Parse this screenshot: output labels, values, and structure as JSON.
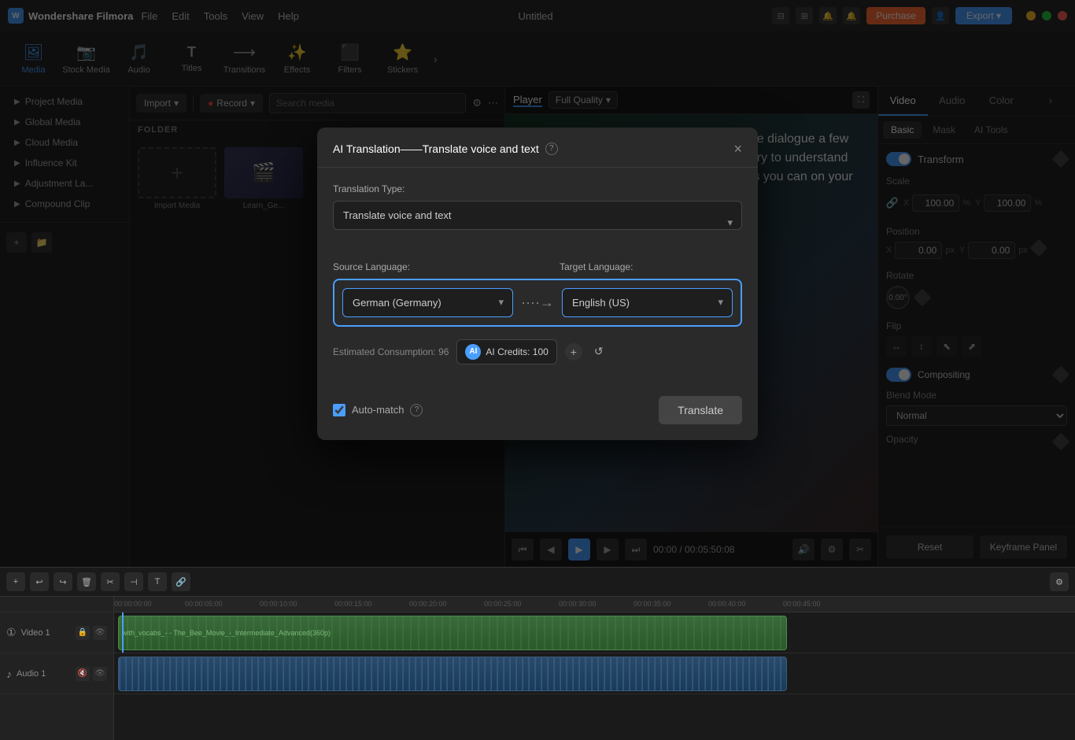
{
  "app": {
    "name": "Wondershare Filmora",
    "title": "Untitled"
  },
  "menu": {
    "items": [
      "File",
      "Edit",
      "Tools",
      "View",
      "Help"
    ]
  },
  "toolbar": {
    "items": [
      {
        "id": "media",
        "label": "Media",
        "icon": "🖼"
      },
      {
        "id": "stock",
        "label": "Stock Media",
        "icon": "📦"
      },
      {
        "id": "audio",
        "label": "Audio",
        "icon": "🎵"
      },
      {
        "id": "titles",
        "label": "Titles",
        "icon": "T"
      },
      {
        "id": "transitions",
        "label": "Transitions",
        "icon": "⟶"
      },
      {
        "id": "effects",
        "label": "Effects",
        "icon": "✨"
      },
      {
        "id": "filters",
        "label": "Filters",
        "icon": "🔲"
      },
      {
        "id": "stickers",
        "label": "Stickers",
        "icon": "⭐"
      }
    ]
  },
  "sidebar": {
    "items": [
      {
        "label": "Project Media",
        "arrow": "▶"
      },
      {
        "label": "Global Media",
        "arrow": "▶"
      },
      {
        "label": "Cloud Media",
        "arrow": "▶"
      },
      {
        "label": "Influence Kit",
        "arrow": "▶"
      },
      {
        "label": "Adjustment La...",
        "arrow": "▶"
      },
      {
        "label": "Compound Clip",
        "arrow": "▶"
      }
    ]
  },
  "media": {
    "folder_label": "FOLDER",
    "import_label": "Import",
    "record_label": "Record",
    "search_placeholder": "Search media",
    "cards": [
      {
        "label": "Import Media",
        "type": "add"
      },
      {
        "label": "Learn_Ge...",
        "type": "thumb"
      }
    ]
  },
  "preview": {
    "player_tab": "Player",
    "quality_label": "Full Quality",
    "preview_text": "Listen to the dialogue a few times and try to understand as much as you can on your own.",
    "time_current": "00:00",
    "time_total": "00:05:50:08"
  },
  "right_panel": {
    "tabs": [
      "Video",
      "Audio",
      "Color"
    ],
    "subtabs": [
      "Basic",
      "Mask",
      "AI Tools"
    ],
    "transform_label": "Transform",
    "transform_enabled": true,
    "scale": {
      "label": "Scale",
      "x_value": "100.00",
      "y_value": "100.00",
      "unit": "%"
    },
    "position": {
      "label": "Position",
      "x_value": "0.00",
      "y_value": "0.00",
      "unit": "px"
    },
    "rotate": {
      "label": "Rotate",
      "value": "0.00°"
    },
    "flip": {
      "label": "Flip"
    },
    "compositing": {
      "label": "Compositing",
      "enabled": true
    },
    "blend_mode": {
      "label": "Blend Mode",
      "value": "Normal"
    },
    "opacity": {
      "label": "Opacity"
    },
    "reset_label": "Reset",
    "keyframe_label": "Keyframe Panel"
  },
  "modal": {
    "title": "AI Translation——Translate voice and text",
    "help_icon": "?",
    "close_icon": "×",
    "translation_type_label": "Translation Type:",
    "translation_type_value": "Translate voice and text",
    "source_lang_label": "Source Language:",
    "target_lang_label": "Target Language:",
    "source_lang_value": "German (Germany)",
    "target_lang_value": "English (US)",
    "estimated_label": "Estimated Consumption: 96",
    "ai_credits_label": "AI Credits: 100",
    "auto_match_label": "Auto-match",
    "translate_btn": "Translate"
  },
  "timeline": {
    "tracks": [
      {
        "label": "Video 1",
        "type": "video"
      },
      {
        "label": "Audio 1",
        "type": "audio"
      }
    ],
    "rulers": [
      "00:00:00:00",
      "00:00:05:00",
      "00:00:10:00",
      "00:00:15:00",
      "00:00:20:00",
      "00:00:25:00",
      "00:00:30:00",
      "00:00:35:00",
      "00:00:40:00",
      "00:00:45:00"
    ]
  }
}
